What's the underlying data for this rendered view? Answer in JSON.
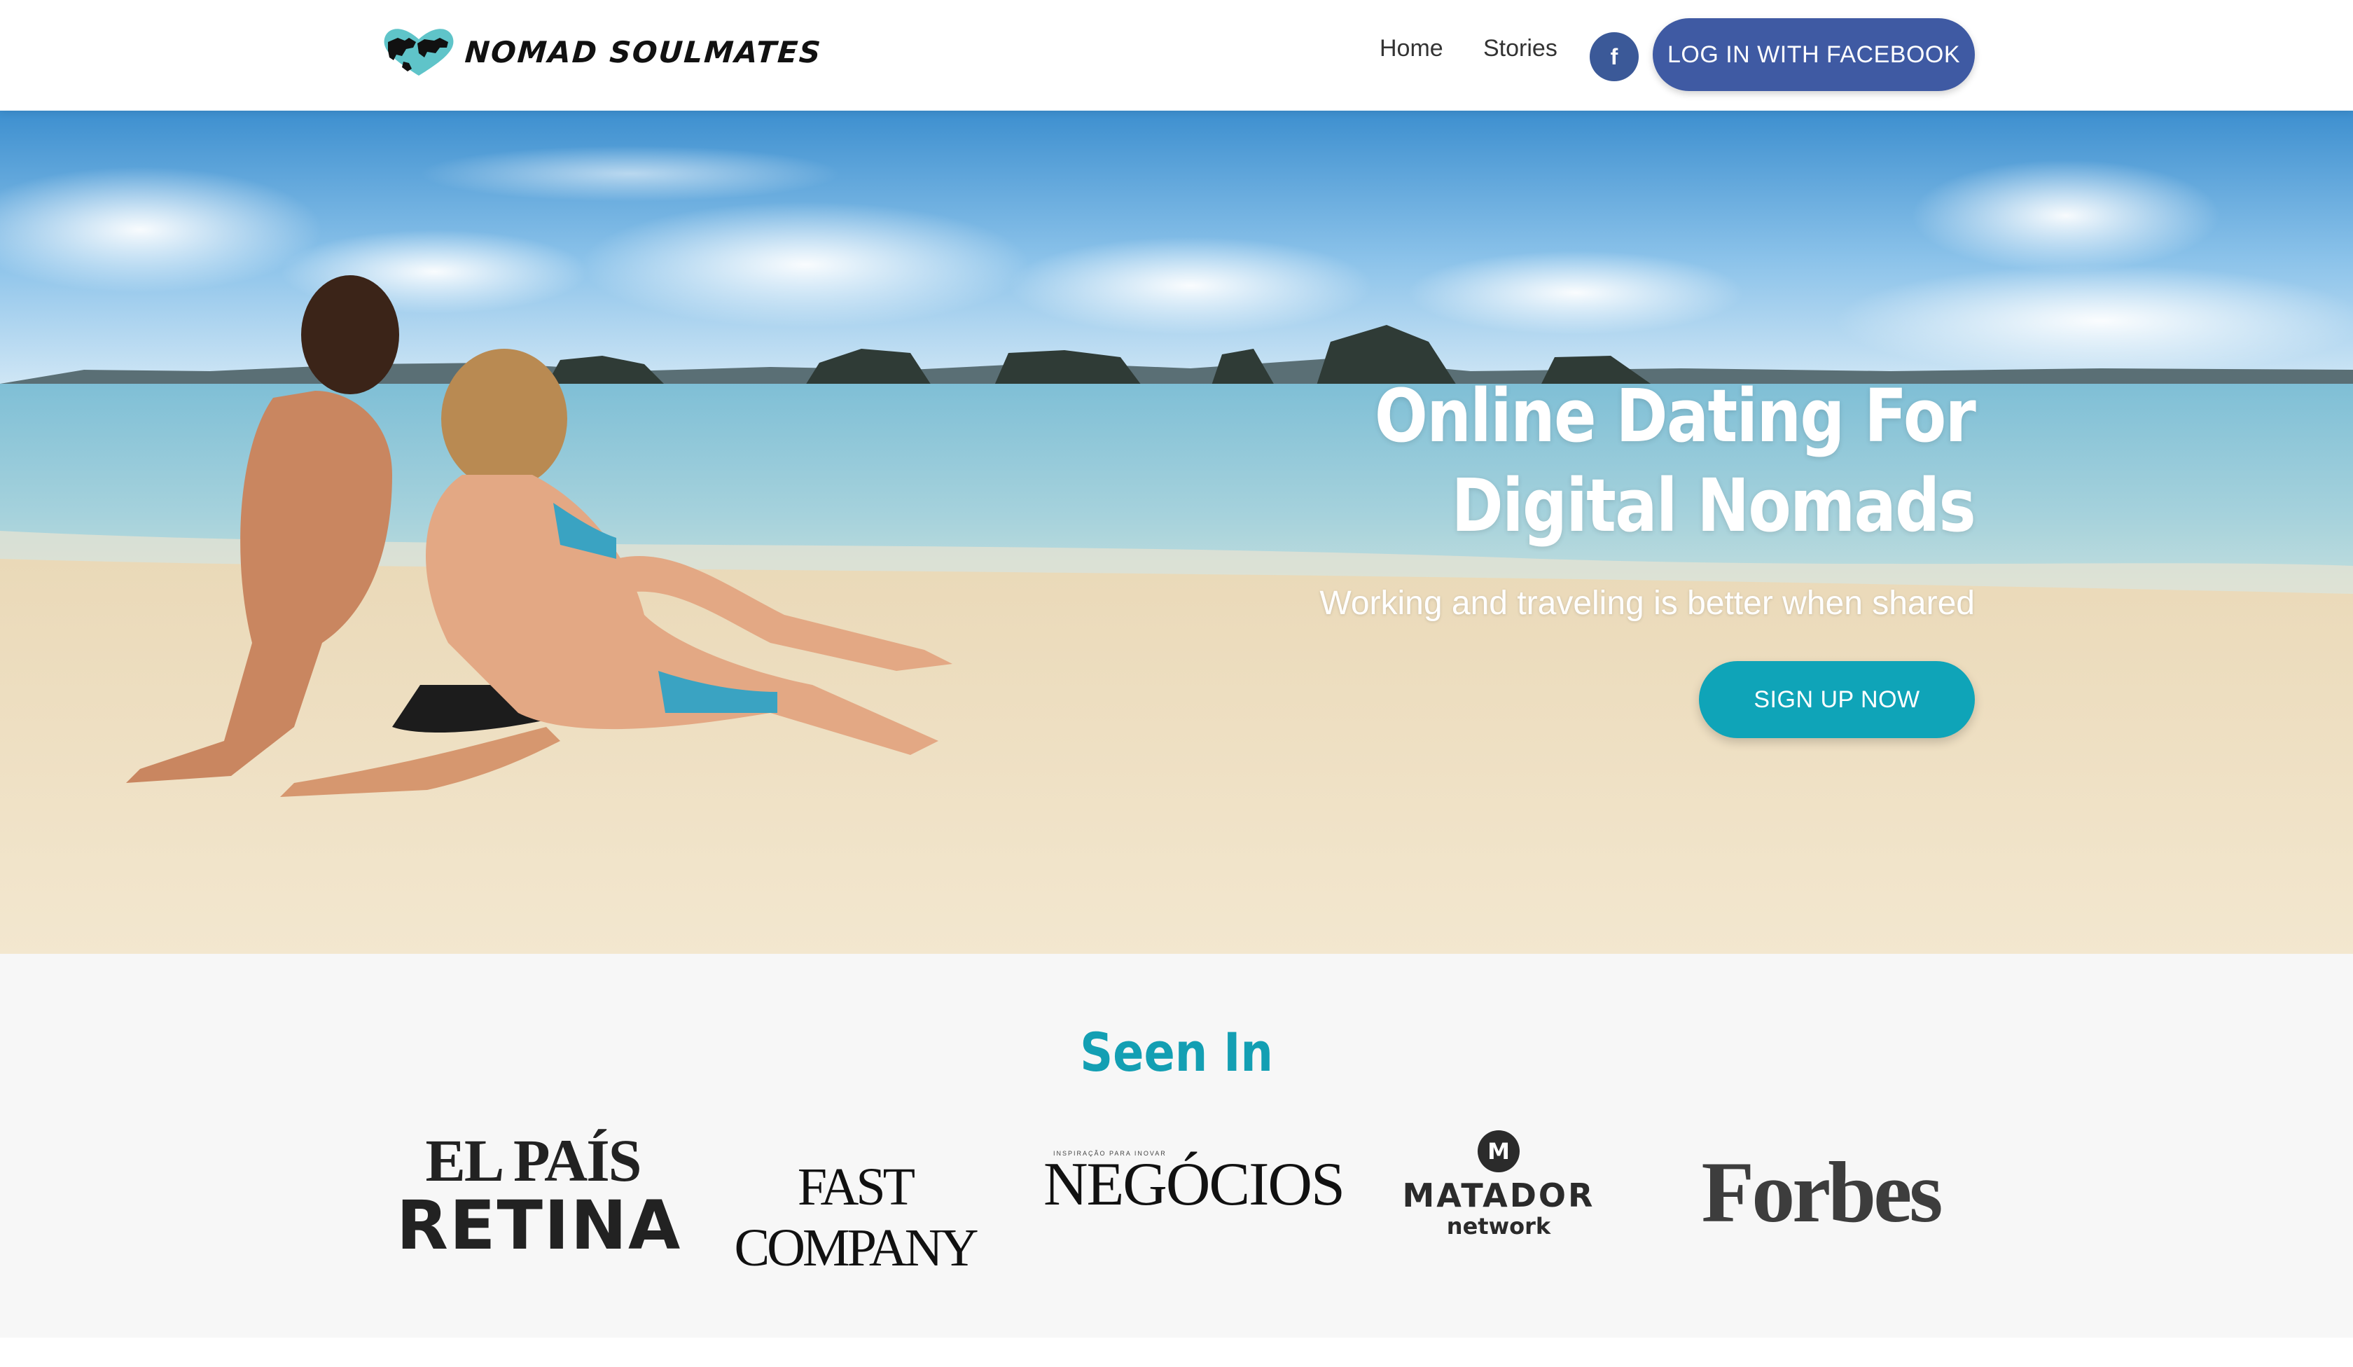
{
  "navbar": {
    "brand": "NOMAD SOULMATES",
    "links": {
      "home": "Home",
      "stories": "Stories"
    },
    "facebook_icon": "f",
    "login_label": "LOG IN WITH FACEBOOK"
  },
  "hero": {
    "title_line1": "Online Dating For",
    "title_line2": "Digital Nomads",
    "subtitle": "Working and traveling is better when shared",
    "cta_label": "SIGN UP NOW"
  },
  "seen_in": {
    "title": "Seen In",
    "logos": {
      "elpais_l1": "EL PAÍS",
      "elpais_l2": "RETINA",
      "fastcompany": "FAST COMPANY",
      "negocios_kicker": "INSPIRAÇÃO PARA INOVAR",
      "negocios": "NEGÓCIOS",
      "matador_badge": "M",
      "matador_name": "MATADOR",
      "matador_net": "network",
      "forbes": "Forbes"
    }
  },
  "colors": {
    "facebook": "#3f5aa3",
    "accent_teal": "#0fa4b8",
    "seen_title": "#139fb3",
    "section_bg": "#f7f7f7"
  },
  "icons": [
    "world-heart-logo-icon",
    "facebook-icon"
  ]
}
